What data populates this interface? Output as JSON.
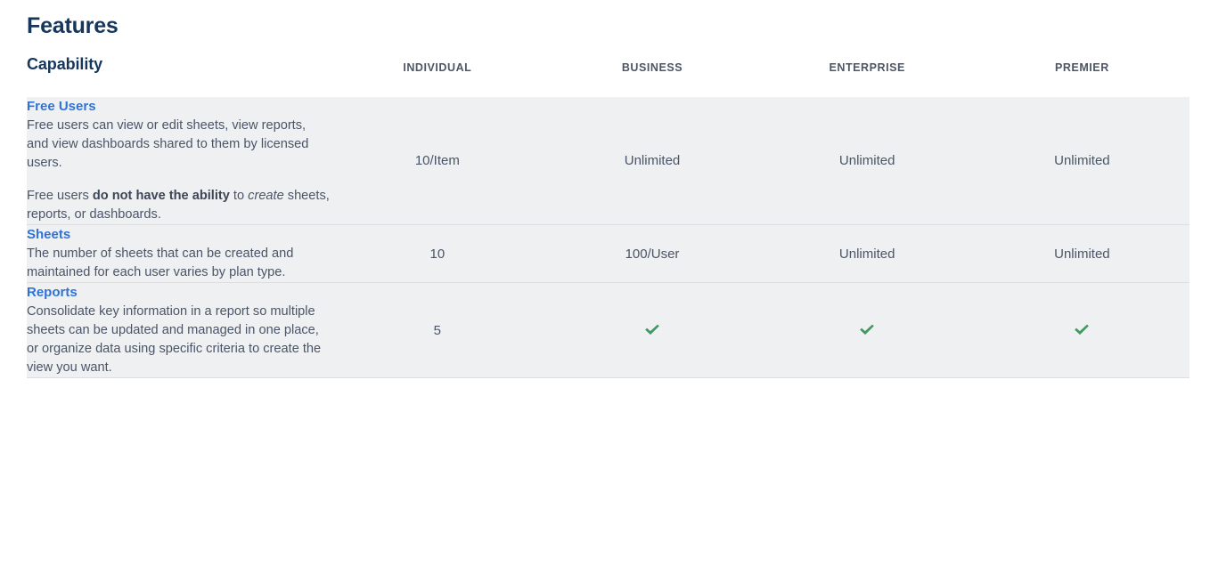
{
  "page": {
    "title": "Features"
  },
  "colors": {
    "heading": "#16365c",
    "link": "#3073d6",
    "body_text": "#4a5568",
    "row_background": "#eff0f2",
    "row_border": "#dcdee1",
    "check_green": "#419863",
    "column_header": "#4d5666"
  },
  "table": {
    "columns": [
      {
        "key": "capability",
        "label": "Capability",
        "align": "left"
      },
      {
        "key": "individual",
        "label": "INDIVIDUAL",
        "align": "center"
      },
      {
        "key": "business",
        "label": "BUSINESS",
        "align": "center"
      },
      {
        "key": "enterprise",
        "label": "ENTERPRISE",
        "align": "center"
      },
      {
        "key": "premier",
        "label": "PREMIER",
        "align": "center"
      }
    ],
    "rows": [
      {
        "name": "Free Users",
        "description_paragraphs": [
          {
            "runs": [
              {
                "text": "Free users can view or edit sheets, view reports, and view dashboards shared to them by licensed users.",
                "style": "normal"
              }
            ]
          },
          {
            "runs": [
              {
                "text": "Free users ",
                "style": "normal"
              },
              {
                "text": "do not have the ability",
                "style": "bold"
              },
              {
                "text": " to ",
                "style": "normal"
              },
              {
                "text": "create",
                "style": "italic"
              },
              {
                "text": " sheets, reports, or dashboards.",
                "style": "normal"
              }
            ]
          }
        ],
        "values": {
          "individual": {
            "type": "text",
            "text": "10/Item"
          },
          "business": {
            "type": "text",
            "text": "Unlimited"
          },
          "enterprise": {
            "type": "text",
            "text": "Unlimited"
          },
          "premier": {
            "type": "text",
            "text": "Unlimited"
          }
        }
      },
      {
        "name": "Sheets",
        "description_paragraphs": [
          {
            "runs": [
              {
                "text": "The number of sheets that can be created and maintained for each user varies by plan type.",
                "style": "normal"
              }
            ]
          }
        ],
        "values": {
          "individual": {
            "type": "text",
            "text": "10"
          },
          "business": {
            "type": "text",
            "text": "100/User"
          },
          "enterprise": {
            "type": "text",
            "text": "Unlimited"
          },
          "premier": {
            "type": "text",
            "text": "Unlimited"
          }
        }
      },
      {
        "name": "Reports",
        "description_paragraphs": [
          {
            "runs": [
              {
                "text": "Consolidate key information in a report so multiple sheets can be updated and managed in one place, or organize data using specific criteria to create the view you want.",
                "style": "normal"
              }
            ]
          }
        ],
        "values": {
          "individual": {
            "type": "text",
            "text": "5"
          },
          "business": {
            "type": "check",
            "text": ""
          },
          "enterprise": {
            "type": "check",
            "text": ""
          },
          "premier": {
            "type": "check",
            "text": ""
          }
        }
      }
    ]
  }
}
